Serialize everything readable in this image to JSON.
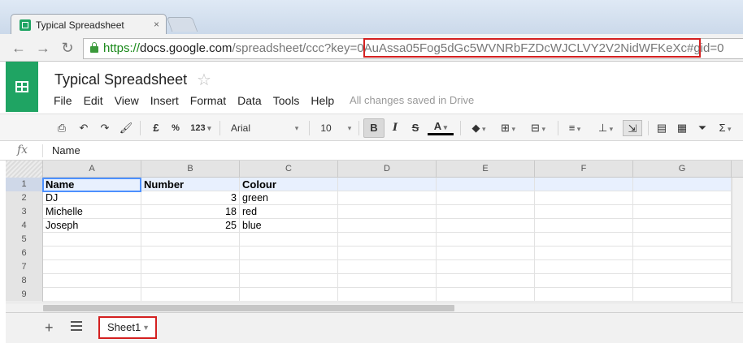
{
  "browser": {
    "tab_title": "Typical Spreadsheet",
    "tab_close": "×",
    "url_scheme": "https://",
    "url_host": "docs.google.com",
    "url_path": "/spreadsheet/ccc?key=",
    "url_key": "0AuAssa05Fog5dGc5WVNRbFZDcWJCLVY2V2NidWFKeXc",
    "url_suffix": "#gid=0"
  },
  "doc": {
    "title": "Typical Spreadsheet",
    "star": "☆",
    "menu": [
      "File",
      "Edit",
      "View",
      "Insert",
      "Format",
      "Data",
      "Tools",
      "Help"
    ],
    "save_status": "All changes saved in Drive"
  },
  "format_toolbar": {
    "currency": "£",
    "percent": "%",
    "more_formats": "123",
    "font": "Arial",
    "font_size": "10",
    "bold": "B",
    "italic": "I",
    "strike": "S",
    "text_color": "A"
  },
  "formula_bar": {
    "fx": "fx",
    "value": "Name"
  },
  "grid": {
    "columns": [
      "A",
      "B",
      "C",
      "D",
      "E",
      "F",
      "G"
    ],
    "rows": [
      {
        "n": "1",
        "a": "Name",
        "b": "Number",
        "c": "Colour"
      },
      {
        "n": "2",
        "a": "DJ",
        "b": "3",
        "c": "green"
      },
      {
        "n": "3",
        "a": "Michelle",
        "b": "18",
        "c": "red"
      },
      {
        "n": "4",
        "a": "Joseph",
        "b": "25",
        "c": "blue"
      },
      {
        "n": "5",
        "a": "",
        "b": "",
        "c": ""
      },
      {
        "n": "6",
        "a": "",
        "b": "",
        "c": ""
      },
      {
        "n": "7",
        "a": "",
        "b": "",
        "c": ""
      },
      {
        "n": "8",
        "a": "",
        "b": "",
        "c": ""
      },
      {
        "n": "9",
        "a": "",
        "b": "",
        "c": ""
      }
    ]
  },
  "sheets": {
    "add": "+",
    "active_sheet": "Sheet1"
  },
  "colors": {
    "sheets_green": "#1fa463",
    "highlight_red": "#d42020",
    "selection_blue": "#4d90fe"
  }
}
